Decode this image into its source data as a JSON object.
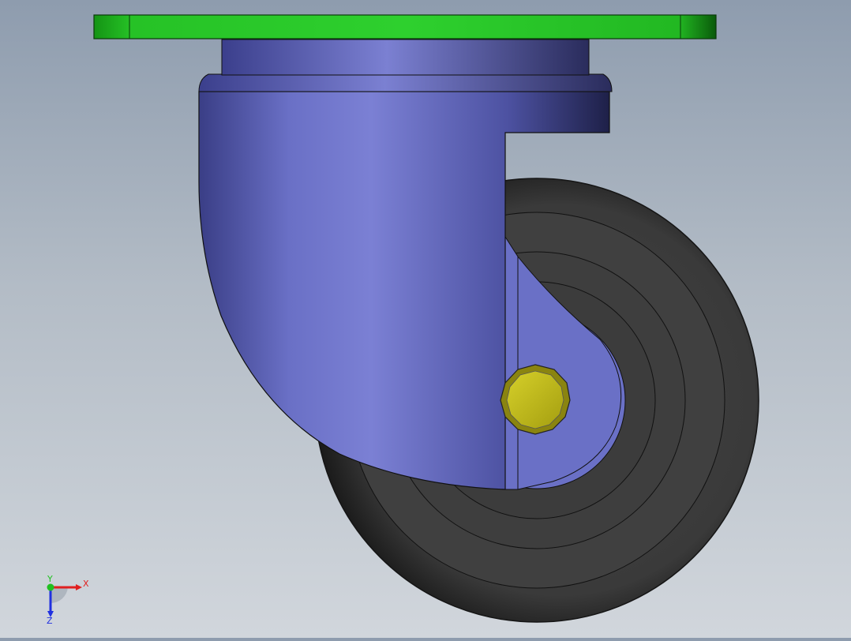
{
  "viewport": {
    "background_top": "#8e9cae",
    "background_bottom": "#d1d6dc"
  },
  "model": {
    "top_plate_color": "#22b822",
    "swivel_housing_color": "#5a60b0",
    "wheel_tire_color": "#3b3b3b",
    "axle_nut_color": "#c9c21a"
  },
  "triad": {
    "x_label": "X",
    "y_label": "Y",
    "z_label": "Z",
    "x_color": "#e02020",
    "y_color": "#20c020",
    "z_color": "#2030e0"
  }
}
